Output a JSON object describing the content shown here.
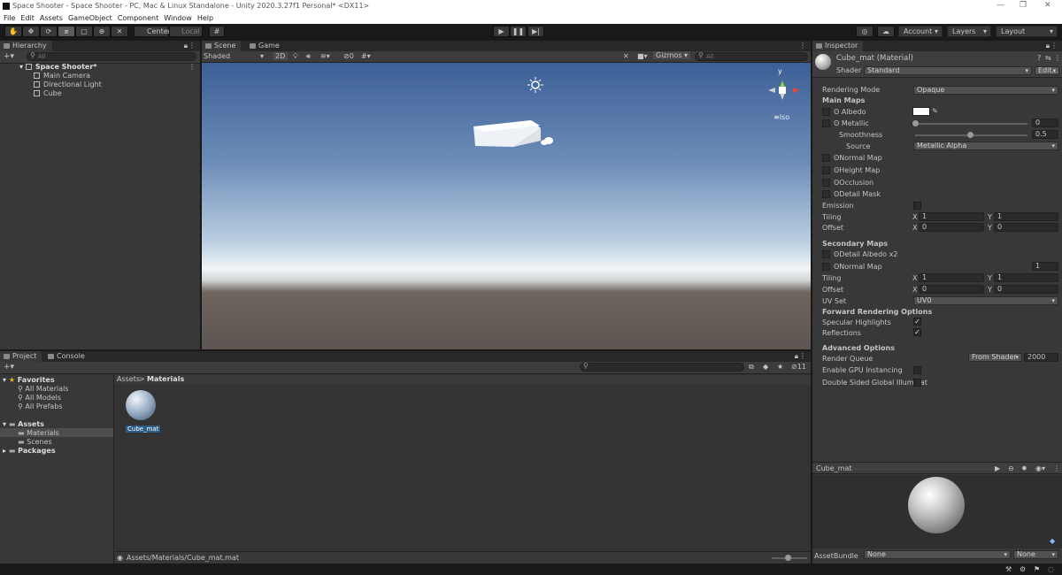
{
  "window": {
    "title": "Space Shooter - Space Shooter - PC, Mac & Linux Standalone - Unity 2020.3.27f1 Personal* <DX11>"
  },
  "menu": [
    "File",
    "Edit",
    "Assets",
    "GameObject",
    "Component",
    "Window",
    "Help"
  ],
  "toolbar": {
    "center": "Center",
    "local": "Local",
    "account": "Account",
    "layers": "Layers",
    "layout": "Layout"
  },
  "hierarchy": {
    "tab": "Hierarchy",
    "search": "All",
    "scene": "Space Shooter*",
    "items": [
      "Main Camera",
      "Directional Light",
      "Cube"
    ]
  },
  "scene": {
    "tab_scene": "Scene",
    "tab_game": "Game",
    "shading": "Shaded",
    "mode2d": "2D",
    "hidden_count": "0",
    "gizmos": "Gizmos",
    "search": "All",
    "gizmo_label": "Iso",
    "axis_y": "y"
  },
  "project": {
    "tab_project": "Project",
    "tab_console": "Console",
    "hidden_count": "11",
    "favorites": "Favorites",
    "fav_items": [
      "All Materials",
      "All Models",
      "All Prefabs"
    ],
    "assets": "Assets",
    "asset_items": [
      "Materials",
      "Scenes"
    ],
    "packages": "Packages",
    "breadcrumb_root": "Assets",
    "breadcrumb_sep": ">",
    "breadcrumb_current": "Materials",
    "asset_name": "Cube_mat",
    "path": "Assets/Materials/Cube_mat.mat"
  },
  "inspector": {
    "tab": "Inspector",
    "title": "Cube_mat (Material)",
    "shader_label": "Shader",
    "shader_value": "Standard",
    "edit": "Edit...",
    "rendering_mode_label": "Rendering Mode",
    "rendering_mode_value": "Opaque",
    "main_maps": "Main Maps",
    "albedo": "Albedo",
    "metallic": "Metallic",
    "metallic_value": "0",
    "smoothness": "Smoothness",
    "smoothness_value": "0.5",
    "source": "Source",
    "source_value": "Metallic Alpha",
    "normal_map": "Normal Map",
    "height_map": "Height Map",
    "occlusion": "Occlusion",
    "detail_mask": "Detail Mask",
    "emission": "Emission",
    "tiling": "Tiling",
    "offset": "Offset",
    "x": "X",
    "y": "Y",
    "tiling_x": "1",
    "tiling_y": "1",
    "offset_x": "0",
    "offset_y": "0",
    "secondary_maps": "Secondary Maps",
    "detail_albedo": "Detail Albedo x2",
    "sec_normal_map": "Normal Map",
    "sec_normal_value": "1",
    "sec_tiling_x": "1",
    "sec_tiling_y": "1",
    "sec_offset_x": "0",
    "sec_offset_y": "0",
    "uv_set_label": "UV Set",
    "uv_set_value": "UV0",
    "forward_rendering": "Forward Rendering Options",
    "specular_highlights": "Specular Highlights",
    "reflections": "Reflections",
    "advanced": "Advanced Options",
    "render_queue": "Render Queue",
    "render_queue_mode": "From Shader",
    "render_queue_value": "2000",
    "gpu_instancing": "Enable GPU Instancing",
    "double_sided": "Double Sided Global Illuminat",
    "preview_title": "Cube_mat",
    "assetbundle_label": "AssetBundle",
    "assetbundle_value": "None",
    "assetbundle_variant": "None",
    "check_mark": "✓"
  },
  "colors": {
    "selection": "#2c5d87",
    "panel": "#383838",
    "toolbar": "#191919"
  },
  "slider": {
    "metallic_fraction": 0,
    "smoothness_fraction": 0.5
  }
}
